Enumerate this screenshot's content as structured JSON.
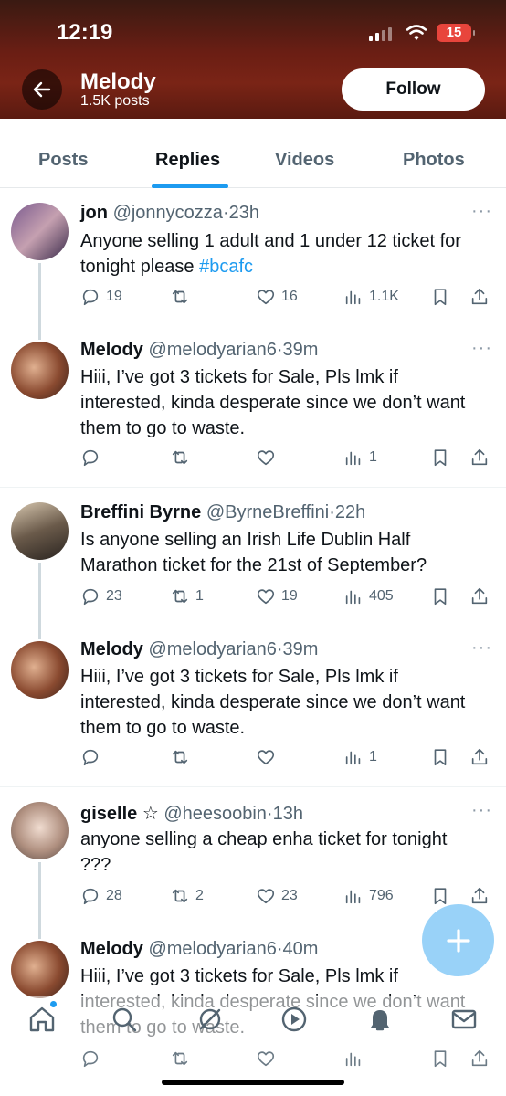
{
  "status_bar": {
    "time": "12:19",
    "battery": "15"
  },
  "profile": {
    "name": "Melody",
    "posts": "1.5K posts",
    "follow_label": "Follow"
  },
  "tabs": [
    {
      "label": "Posts"
    },
    {
      "label": "Replies"
    },
    {
      "label": "Videos"
    },
    {
      "label": "Photos"
    }
  ],
  "tweets": [
    {
      "name": "jon",
      "handle": "@jonnycozza",
      "time": "23h",
      "body": "Anyone selling 1 adult and 1 under 12 ticket for tonight please",
      "hashtag": "#bcafc",
      "replies": "19",
      "retweets": "",
      "likes": "16",
      "views": "1.1K"
    },
    {
      "name": "Melody",
      "handle": "@melodyarian6",
      "time": "39m",
      "body": "Hiii, I’ve got 3 tickets for Sale, Pls lmk if interested, kinda desperate since we don’t want them to go to waste.",
      "replies": "",
      "retweets": "",
      "likes": "",
      "views": "1"
    },
    {
      "name": "Breffini Byrne",
      "handle": "@ByrneBreffini",
      "time": "22h",
      "body": "Is anyone selling an Irish Life Dublin Half Marathon ticket for the 21st of September?",
      "replies": "23",
      "retweets": "1",
      "likes": "19",
      "views": "405"
    },
    {
      "name": "Melody",
      "handle": "@melodyarian6",
      "time": "39m",
      "body": "Hiii, I’ve got 3 tickets for Sale, Pls lmk if interested, kinda desperate since we don’t want them to go to waste.",
      "replies": "",
      "retweets": "",
      "likes": "",
      "views": "1"
    },
    {
      "name": "giselle ☆",
      "handle": "@heesoobin",
      "time": "13h",
      "body": "anyone selling a cheap enha ticket for tonight ???",
      "replies": "28",
      "retweets": "2",
      "likes": "23",
      "views": "796"
    },
    {
      "name": "Melody",
      "handle": "@melodyarian6",
      "time": "40m",
      "body": "Hiii, I’ve got 3 tickets for Sale, Pls lmk if interested, kinda desperate since we don’t want them to go to waste.",
      "replies": "",
      "retweets": "",
      "likes": "",
      "views": ""
    }
  ],
  "colors": {
    "accent": "#1d9bf0",
    "text": "#0f1419",
    "muted": "#536471",
    "header": "#6b1e14"
  },
  "icons": [
    "back-arrow-icon",
    "reply-icon",
    "retweet-icon",
    "like-icon",
    "views-icon",
    "bookmark-icon",
    "share-icon",
    "more-icon",
    "compose-icon",
    "home-icon",
    "search-icon",
    "grok-icon",
    "video-icon",
    "notifications-icon",
    "messages-icon"
  ]
}
